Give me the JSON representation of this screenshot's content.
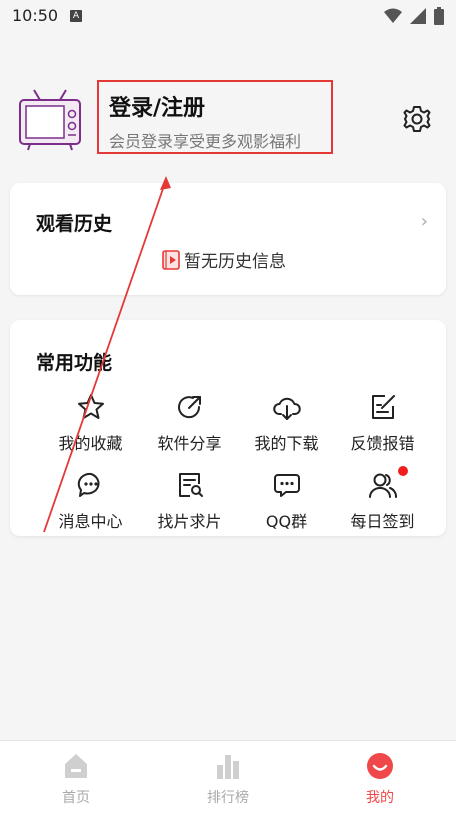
{
  "status_bar": {
    "time": "10:50",
    "indicator": "A"
  },
  "profile": {
    "title": "登录/注册",
    "subtitle": "会员登录享受更多观影福利"
  },
  "history": {
    "title": "观看历史",
    "chevron": "›",
    "empty_text": "暂无历史信息"
  },
  "functions": {
    "title": "常用功能",
    "items": [
      {
        "label": "我的收藏",
        "icon": "star-icon"
      },
      {
        "label": "软件分享",
        "icon": "share-icon"
      },
      {
        "label": "我的下载",
        "icon": "cloud-download-icon"
      },
      {
        "label": "反馈报错",
        "icon": "feedback-icon"
      },
      {
        "label": "消息中心",
        "icon": "message-icon"
      },
      {
        "label": "找片求片",
        "icon": "search-doc-icon"
      },
      {
        "label": "QQ群",
        "icon": "chat-icon"
      },
      {
        "label": "每日签到",
        "icon": "users-icon"
      }
    ]
  },
  "tabs": [
    {
      "label": "首页",
      "icon": "home-icon",
      "active": false
    },
    {
      "label": "排行榜",
      "icon": "bar-chart-icon",
      "active": false
    },
    {
      "label": "我的",
      "icon": "smile-icon",
      "active": true
    }
  ],
  "colors": {
    "accent": "#f0484a",
    "annotation": "#e53935",
    "badge": "#f01e1e"
  }
}
